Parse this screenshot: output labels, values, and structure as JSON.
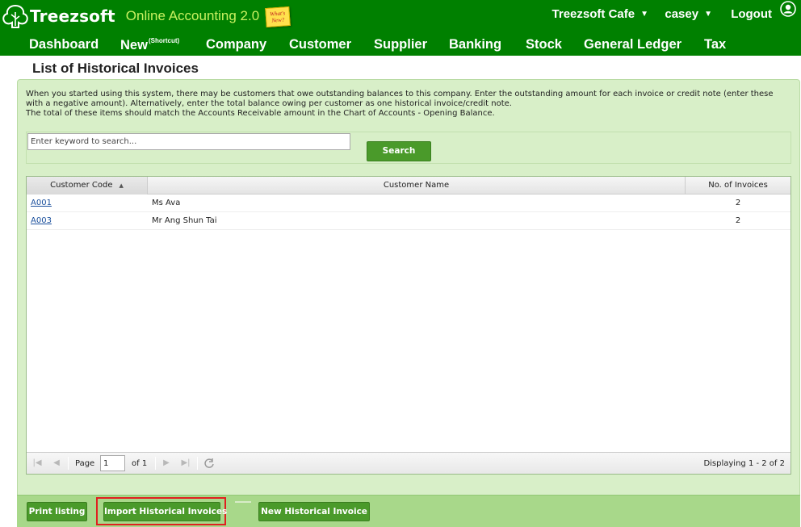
{
  "header": {
    "brand_name": "Treezsoft",
    "brand_subtitle": "Online Accounting 2.0",
    "whats_new_label": "What's New?",
    "company_menu": "Treezsoft Cafe",
    "user_menu": "casey",
    "logout_label": "Logout"
  },
  "nav": {
    "items": [
      {
        "label": "Dashboard"
      },
      {
        "label": "New",
        "sup": "(Shortcut)"
      },
      {
        "label": "Company"
      },
      {
        "label": "Customer"
      },
      {
        "label": "Supplier"
      },
      {
        "label": "Banking"
      },
      {
        "label": "Stock"
      },
      {
        "label": "General Ledger"
      },
      {
        "label": "Tax"
      }
    ]
  },
  "page": {
    "title": "List of Historical Invoices",
    "intro_lines": [
      "When you started using this system, there may be customers that owe outstanding balances to this company. Enter the outstanding amount for each invoice or credit note (enter these with a negative amount). Alternatively, enter the total balance owing per customer as one historical invoice/credit note.",
      "The total of these items should match the Accounts Receivable amount in the Chart of Accounts - Opening Balance."
    ]
  },
  "search": {
    "placeholder": "Enter keyword to search...",
    "value": "",
    "button_label": "Search"
  },
  "grid": {
    "columns": [
      "Customer Code",
      "Customer Name",
      "No. of Invoices"
    ],
    "sort_indicator": "▲",
    "rows": [
      {
        "code": "A001",
        "name": "Ms Ava",
        "count": "2"
      },
      {
        "code": "A003",
        "name": "Mr Ang Shun Tai",
        "count": "2"
      }
    ],
    "pager": {
      "page_label": "Page",
      "page_value": "1",
      "of_label": "of 1",
      "display_text": "Displaying 1 - 2 of 2"
    }
  },
  "footer": {
    "print_label": "Print listing",
    "import_label": "Import Historical Invoices",
    "new_label": "New Historical Invoice"
  },
  "colors": {
    "header_green": "#008000",
    "subtitle_lime": "#c8f060",
    "panel_bg": "#d8efc8",
    "button_green": "#4a9a2a",
    "footer_green": "#a8d88a",
    "highlight_red": "#e02020",
    "link_blue": "#1a4f9c"
  },
  "icons": {
    "brand": "tree-logo-icon",
    "user": "user-circle-icon",
    "first": "first-page-icon",
    "prev": "prev-page-icon",
    "next": "next-page-icon",
    "last": "last-page-icon",
    "refresh": "refresh-icon"
  }
}
